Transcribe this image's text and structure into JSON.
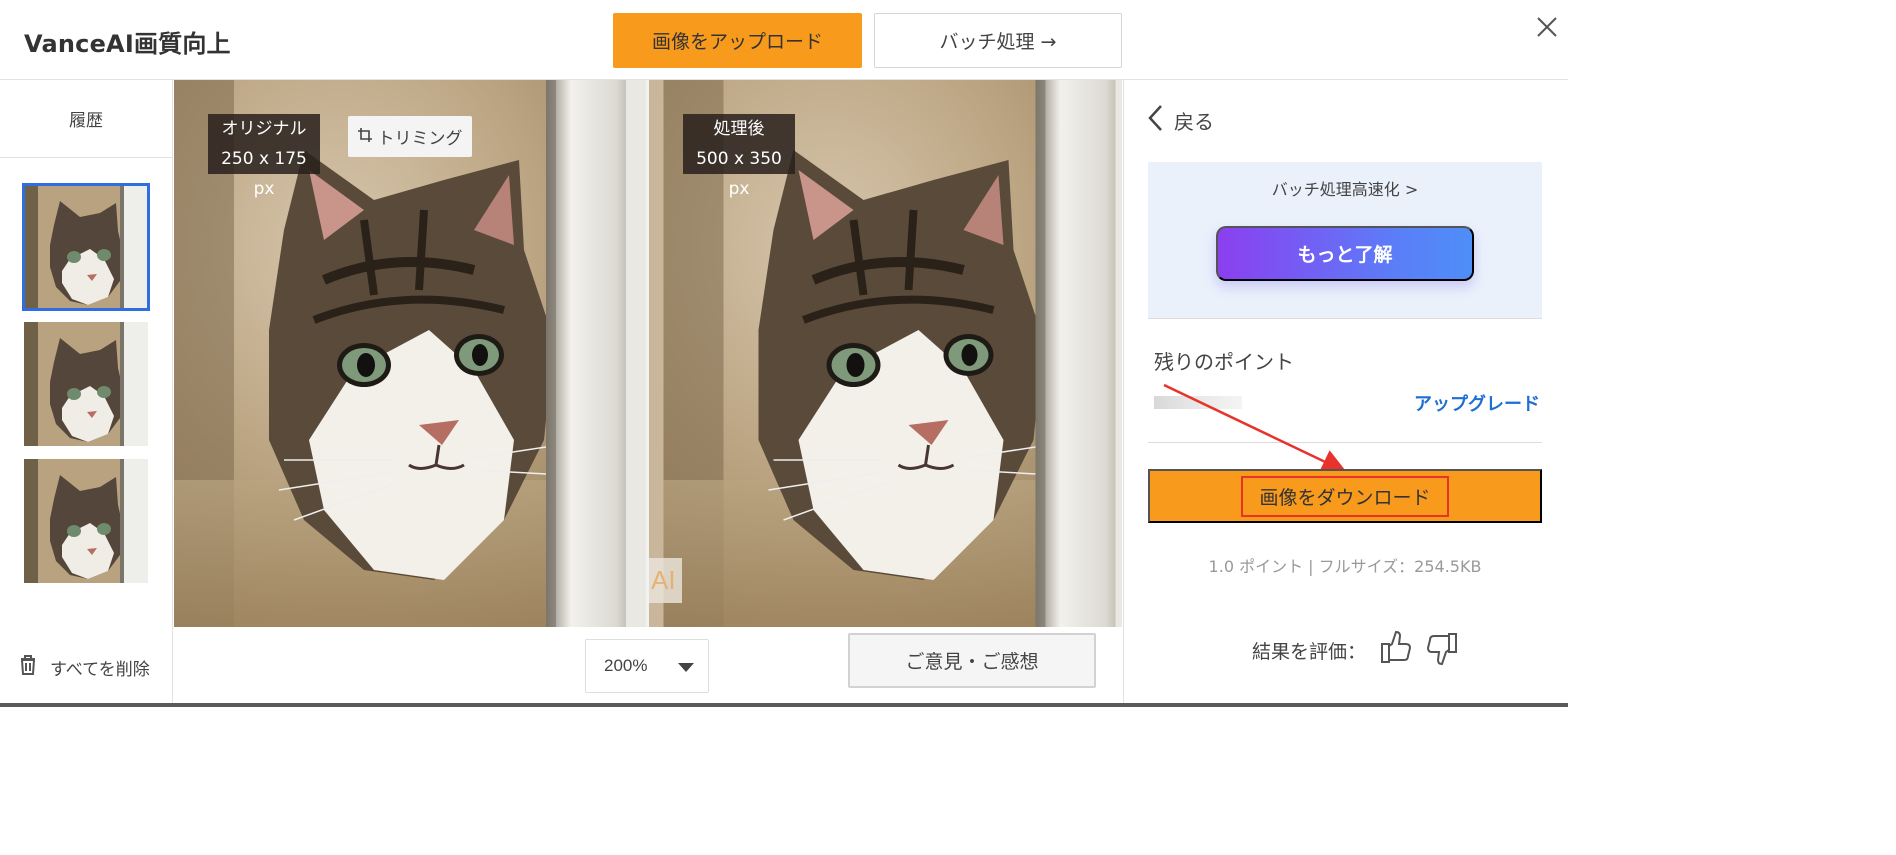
{
  "header": {
    "title": "VanceAI画質向上",
    "upload_button": "画像をアップロード",
    "batch_button": "バッチ処理 →"
  },
  "history": {
    "title": "履歴",
    "delete_all": "すべてを削除",
    "thumbnails": [
      "cat-thumbnail",
      "cat-thumbnail",
      "cat-thumbnail"
    ]
  },
  "viewer": {
    "original": {
      "label": "オリジナル",
      "size": "250 x 175 px"
    },
    "processed": {
      "label": "処理後",
      "size": "500 x 350 px"
    },
    "trim_button": "トリミング",
    "watermark": "AI"
  },
  "bottom": {
    "zoom": "200%",
    "feedback_button": "ご意見・ご感想"
  },
  "panel": {
    "back": "戻る",
    "promo_text": "バッチ処理高速化 >",
    "learn_more": "もっと了解",
    "points_title": "残りのポイント",
    "upgrade": "アップグレード",
    "download": "画像をダウンロード",
    "meta": "1.0 ポイント | フルサイズ：254.5KB",
    "rate_label": "結果を評価：",
    "icons": [
      "thumbs-up-icon",
      "thumbs-down-icon",
      "chevron-left-icon",
      "trash-icon",
      "crop-icon",
      "close-icon"
    ]
  },
  "colors": {
    "accent_orange": "#f89a1c",
    "link_blue": "#1e6fd2",
    "selection_blue": "#2f6de1",
    "annotation_red": "#e8332c",
    "promo_bg": "#eaf1fb"
  }
}
